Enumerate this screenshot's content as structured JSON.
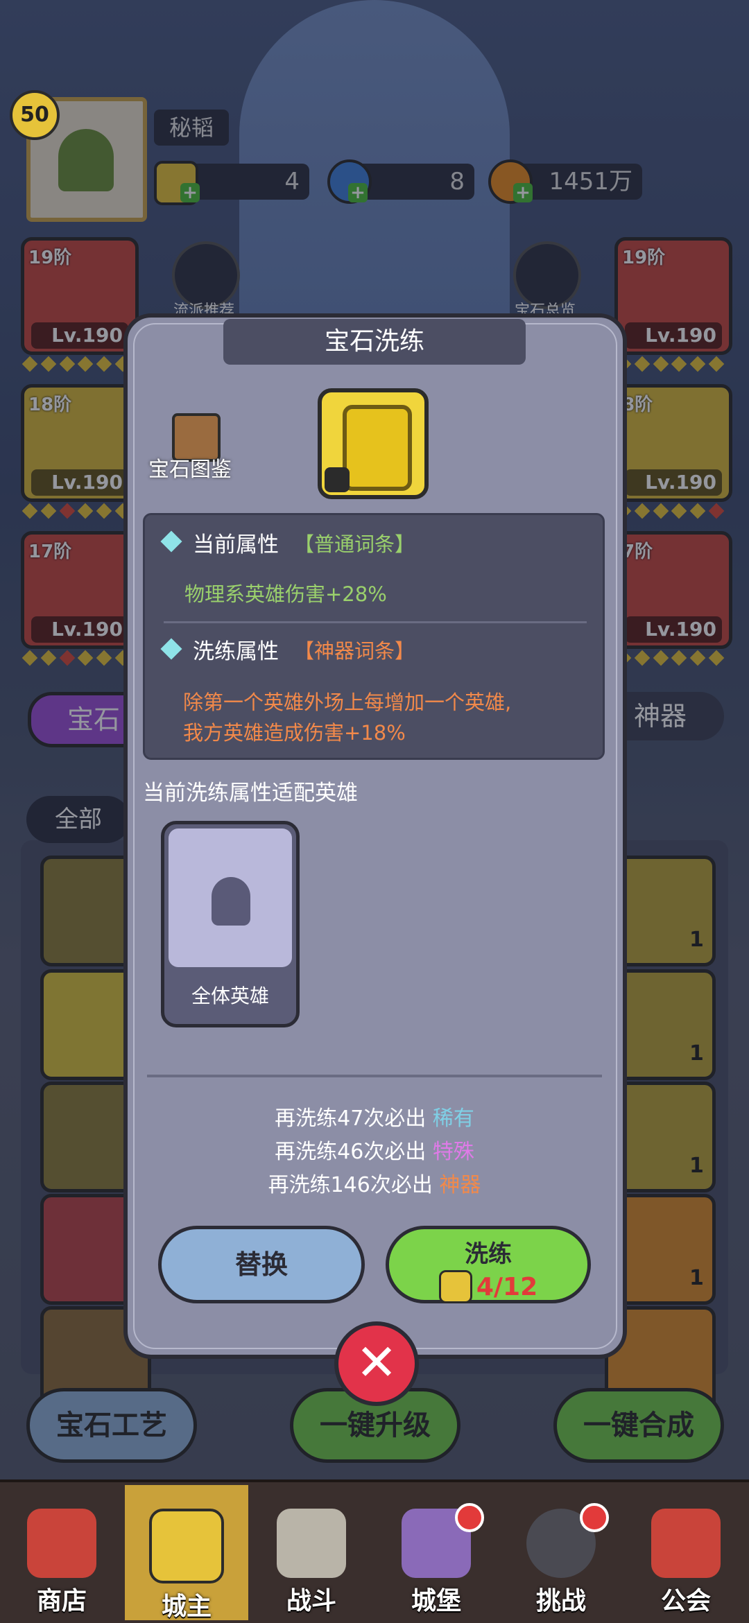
{
  "player": {
    "level": "50",
    "name": "秘韬"
  },
  "resources": [
    {
      "icon": "gold-gem-icon",
      "value": "4"
    },
    {
      "icon": "potion-icon",
      "value": "8"
    },
    {
      "icon": "coin-icon",
      "value": "1451万"
    }
  ],
  "equipment_left": [
    {
      "tier": "19阶",
      "level": "Lv.190"
    },
    {
      "tier": "18阶",
      "level": "Lv.190"
    },
    {
      "tier": "17阶",
      "level": "Lv.190"
    }
  ],
  "equipment_right": [
    {
      "tier": "19阶",
      "level": "Lv.190"
    },
    {
      "tier": "8阶",
      "level": "Lv.190"
    },
    {
      "tier": "7阶",
      "level": "Lv.190"
    }
  ],
  "side_buttons": {
    "left": "流派推荐",
    "right": "宝石总览"
  },
  "tabs": {
    "gem": "宝石",
    "artifact": "神器",
    "filter": "全部"
  },
  "gem_counts": [
    "1",
    "1",
    "1",
    "1"
  ],
  "bottom_buttons": {
    "craft": "宝石工艺",
    "upgrade": "一键升级",
    "merge": "一键合成"
  },
  "nav": [
    {
      "label": "商店",
      "icon": "shop-icon"
    },
    {
      "label": "城主",
      "icon": "crown-icon"
    },
    {
      "label": "战斗",
      "icon": "swords-icon"
    },
    {
      "label": "城堡",
      "icon": "castle-icon"
    },
    {
      "label": "挑战",
      "icon": "demon-icon"
    },
    {
      "label": "公会",
      "icon": "guild-banner-icon"
    }
  ],
  "modal": {
    "title": "宝石洗练",
    "codex": "宝石图鉴",
    "current_attr_label": "当前属性",
    "current_attr_tag": "【普通词条】",
    "current_attr_text": "物理系英雄伤害+28%",
    "refine_attr_label": "洗练属性",
    "refine_attr_tag": "【神器词条】",
    "refine_attr_text_1": "除第一个英雄外场上每增加一个英雄,",
    "refine_attr_text_2": "我方英雄造成伤害+18%",
    "fit_heroes_label": "当前洗练属性适配英雄",
    "hero_card_label": "全体英雄",
    "pity": [
      {
        "prefix": "再洗练47次必出",
        "rarity": "稀有",
        "color": "#7fd0e6"
      },
      {
        "prefix": "再洗练46次必出",
        "rarity": "特殊",
        "color": "#e07ae8"
      },
      {
        "prefix": "再洗练146次必出",
        "rarity": "神器",
        "color": "#f2894a"
      }
    ],
    "replace_button": "替换",
    "refine_button": "洗练",
    "refine_cost": "4/12"
  },
  "colors": {
    "modal_bg": "#8c8ea6",
    "dark_panel": "#4c4e63",
    "green_btn": "#7cd34a",
    "blue_btn": "#8fb0d6"
  }
}
